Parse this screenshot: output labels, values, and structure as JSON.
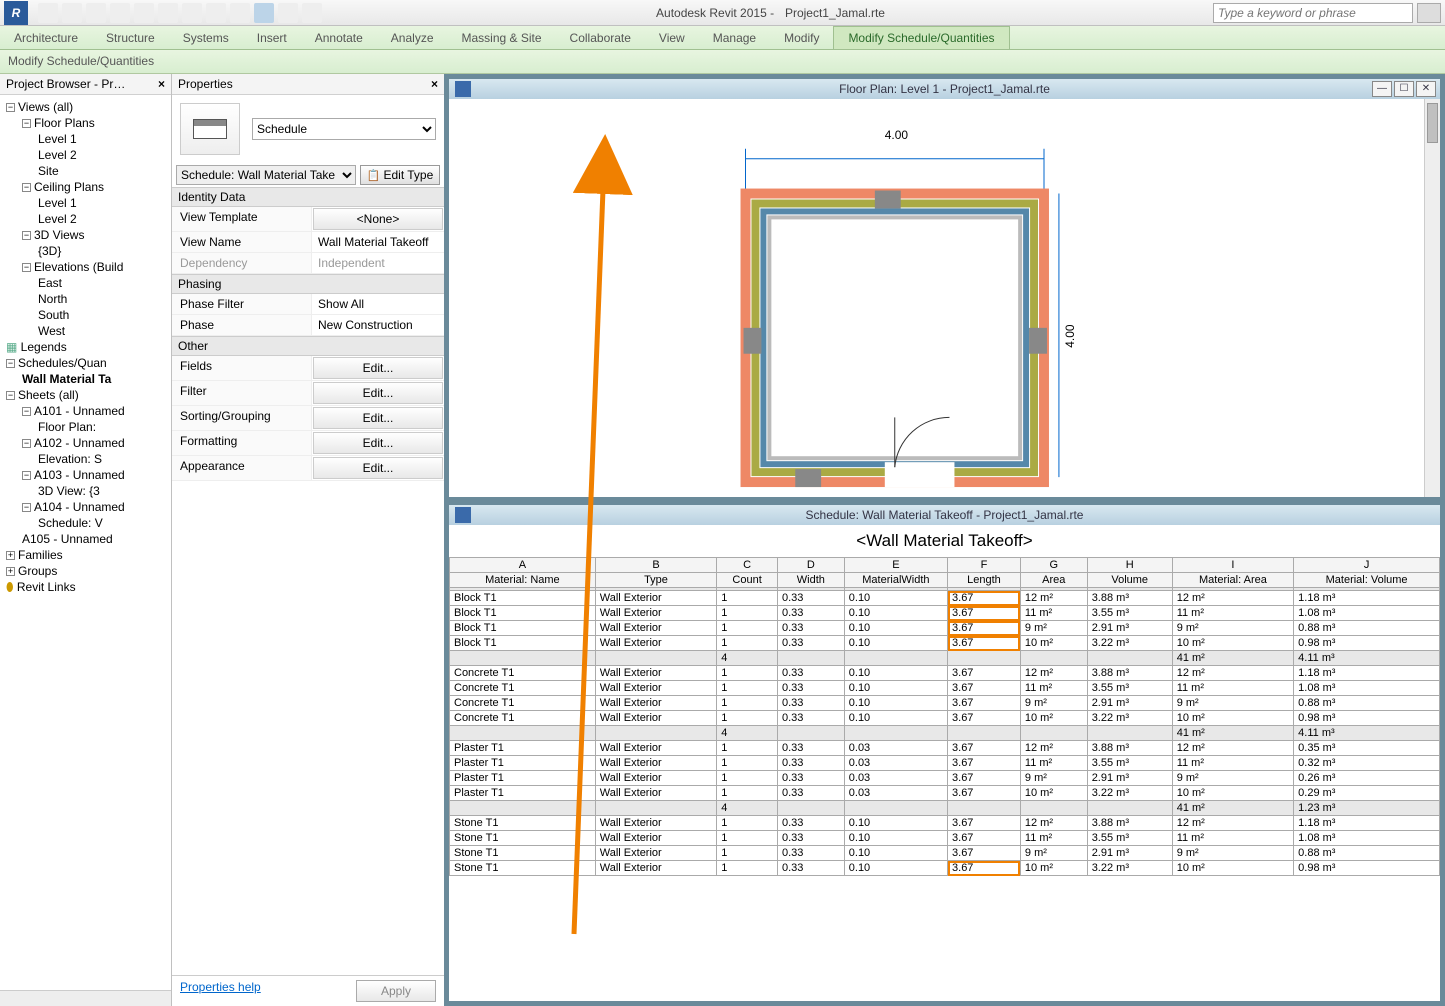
{
  "app": {
    "title_left": "Autodesk Revit 2015 -",
    "title_file": "Project1_Jamal.rte",
    "search_placeholder": "Type a keyword or phrase"
  },
  "ribbon": {
    "tabs": [
      "Architecture",
      "Structure",
      "Systems",
      "Insert",
      "Annotate",
      "Analyze",
      "Massing & Site",
      "Collaborate",
      "View",
      "Manage",
      "Modify",
      "Modify Schedule/Quantities"
    ],
    "panel_label": "Modify Schedule/Quantities"
  },
  "browser": {
    "title": "Project Browser - Pr…",
    "tree": [
      {
        "lvl": 1,
        "label": "Views (all)",
        "box": "-"
      },
      {
        "lvl": 2,
        "label": "Floor Plans",
        "box": "-"
      },
      {
        "lvl": 3,
        "label": "Level 1"
      },
      {
        "lvl": 3,
        "label": "Level 2"
      },
      {
        "lvl": 3,
        "label": "Site"
      },
      {
        "lvl": 2,
        "label": "Ceiling Plans",
        "box": "-"
      },
      {
        "lvl": 3,
        "label": "Level 1"
      },
      {
        "lvl": 3,
        "label": "Level 2"
      },
      {
        "lvl": 2,
        "label": "3D Views",
        "box": "-"
      },
      {
        "lvl": 3,
        "label": "{3D}"
      },
      {
        "lvl": 2,
        "label": "Elevations (Build",
        "box": "-"
      },
      {
        "lvl": 3,
        "label": "East"
      },
      {
        "lvl": 3,
        "label": "North"
      },
      {
        "lvl": 3,
        "label": "South"
      },
      {
        "lvl": 3,
        "label": "West"
      },
      {
        "lvl": 1,
        "label": "Legends",
        "icon": "legend"
      },
      {
        "lvl": 1,
        "label": "Schedules/Quan",
        "box": "-"
      },
      {
        "lvl": 2,
        "label": "Wall Material Ta",
        "bold": true
      },
      {
        "lvl": 1,
        "label": "Sheets (all)",
        "box": "-"
      },
      {
        "lvl": 2,
        "label": "A101 - Unnamed",
        "box": "-"
      },
      {
        "lvl": 3,
        "label": "Floor Plan:"
      },
      {
        "lvl": 2,
        "label": "A102 - Unnamed",
        "box": "-"
      },
      {
        "lvl": 3,
        "label": "Elevation: S"
      },
      {
        "lvl": 2,
        "label": "A103 - Unnamed",
        "box": "-"
      },
      {
        "lvl": 3,
        "label": "3D View: {3"
      },
      {
        "lvl": 2,
        "label": "A104 - Unnamed",
        "box": "-"
      },
      {
        "lvl": 3,
        "label": "Schedule: V"
      },
      {
        "lvl": 2,
        "label": "A105 - Unnamed"
      },
      {
        "lvl": 1,
        "label": "Families",
        "box": "+"
      },
      {
        "lvl": 1,
        "label": "Groups",
        "box": "+"
      },
      {
        "lvl": 1,
        "label": "Revit Links",
        "icon": "link"
      }
    ]
  },
  "properties": {
    "title": "Properties",
    "type_selector": "Schedule",
    "instance_selector": "Schedule: Wall Material Take",
    "edit_type": "Edit Type",
    "groups": [
      {
        "name": "Identity Data",
        "rows": [
          {
            "k": "View Template",
            "v": "<None>",
            "btn": true
          },
          {
            "k": "View Name",
            "v": "Wall Material Takeoff"
          },
          {
            "k": "Dependency",
            "v": "Independent",
            "dim": true
          }
        ]
      },
      {
        "name": "Phasing",
        "rows": [
          {
            "k": "Phase Filter",
            "v": "Show All"
          },
          {
            "k": "Phase",
            "v": "New Construction"
          }
        ]
      },
      {
        "name": "Other",
        "rows": [
          {
            "k": "Fields",
            "v": "Edit...",
            "btn": true
          },
          {
            "k": "Filter",
            "v": "Edit...",
            "btn": true
          },
          {
            "k": "Sorting/Grouping",
            "v": "Edit...",
            "btn": true
          },
          {
            "k": "Formatting",
            "v": "Edit...",
            "btn": true
          },
          {
            "k": "Appearance",
            "v": "Edit...",
            "btn": true
          }
        ]
      }
    ],
    "help": "Properties help",
    "apply": "Apply"
  },
  "floorplan": {
    "title": "Floor Plan: Level 1 - Project1_Jamal.rte",
    "dim_h": "4.00",
    "dim_v": "4.00"
  },
  "schedule": {
    "title": "Schedule: Wall Material Takeoff - Project1_Jamal.rte",
    "heading": "<Wall Material Takeoff>",
    "col_letters": [
      "A",
      "B",
      "C",
      "D",
      "E",
      "F",
      "G",
      "H",
      "I",
      "J"
    ],
    "col_names": [
      "Material: Name",
      "Type",
      "Count",
      "Width",
      "MaterialWidth",
      "Length",
      "Area",
      "Volume",
      "Material: Area",
      "Material: Volume"
    ],
    "groups": [
      {
        "rows": [
          [
            "Block T1",
            "Wall Exterior",
            "1",
            "0.33",
            "0.10",
            "3.67",
            "12 m²",
            "3.88 m³",
            "12 m²",
            "1.18 m³"
          ],
          [
            "Block T1",
            "Wall Exterior",
            "1",
            "0.33",
            "0.10",
            "3.67",
            "11 m²",
            "3.55 m³",
            "11 m²",
            "1.08 m³"
          ],
          [
            "Block T1",
            "Wall Exterior",
            "1",
            "0.33",
            "0.10",
            "3.67",
            "9 m²",
            "2.91 m³",
            "9 m²",
            "0.88 m³"
          ],
          [
            "Block T1",
            "Wall Exterior",
            "1",
            "0.33",
            "0.10",
            "3.67",
            "10 m²",
            "3.22 m³",
            "10 m²",
            "0.98 m³"
          ]
        ],
        "sub": [
          "",
          "",
          "4",
          "",
          "",
          "",
          "",
          "",
          "41 m²",
          "4.11 m³"
        ],
        "hl": true
      },
      {
        "rows": [
          [
            "Concrete T1",
            "Wall Exterior",
            "1",
            "0.33",
            "0.10",
            "3.67",
            "12 m²",
            "3.88 m³",
            "12 m²",
            "1.18 m³"
          ],
          [
            "Concrete T1",
            "Wall Exterior",
            "1",
            "0.33",
            "0.10",
            "3.67",
            "11 m²",
            "3.55 m³",
            "11 m²",
            "1.08 m³"
          ],
          [
            "Concrete T1",
            "Wall Exterior",
            "1",
            "0.33",
            "0.10",
            "3.67",
            "9 m²",
            "2.91 m³",
            "9 m²",
            "0.88 m³"
          ],
          [
            "Concrete T1",
            "Wall Exterior",
            "1",
            "0.33",
            "0.10",
            "3.67",
            "10 m²",
            "3.22 m³",
            "10 m²",
            "0.98 m³"
          ]
        ],
        "sub": [
          "",
          "",
          "4",
          "",
          "",
          "",
          "",
          "",
          "41 m²",
          "4.11 m³"
        ]
      },
      {
        "rows": [
          [
            "Plaster T1",
            "Wall Exterior",
            "1",
            "0.33",
            "0.03",
            "3.67",
            "12 m²",
            "3.88 m³",
            "12 m²",
            "0.35 m³"
          ],
          [
            "Plaster T1",
            "Wall Exterior",
            "1",
            "0.33",
            "0.03",
            "3.67",
            "11 m²",
            "3.55 m³",
            "11 m²",
            "0.32 m³"
          ],
          [
            "Plaster T1",
            "Wall Exterior",
            "1",
            "0.33",
            "0.03",
            "3.67",
            "9 m²",
            "2.91 m³",
            "9 m²",
            "0.26 m³"
          ],
          [
            "Plaster T1",
            "Wall Exterior",
            "1",
            "0.33",
            "0.03",
            "3.67",
            "10 m²",
            "3.22 m³",
            "10 m²",
            "0.29 m³"
          ]
        ],
        "sub": [
          "",
          "",
          "4",
          "",
          "",
          "",
          "",
          "",
          "41 m²",
          "1.23 m³"
        ]
      },
      {
        "rows": [
          [
            "Stone T1",
            "Wall Exterior",
            "1",
            "0.33",
            "0.10",
            "3.67",
            "12 m²",
            "3.88 m³",
            "12 m²",
            "1.18 m³"
          ],
          [
            "Stone T1",
            "Wall Exterior",
            "1",
            "0.33",
            "0.10",
            "3.67",
            "11 m²",
            "3.55 m³",
            "11 m²",
            "1.08 m³"
          ],
          [
            "Stone T1",
            "Wall Exterior",
            "1",
            "0.33",
            "0.10",
            "3.67",
            "9 m²",
            "2.91 m³",
            "9 m²",
            "0.88 m³"
          ],
          [
            "Stone T1",
            "Wall Exterior",
            "1",
            "0.33",
            "0.10",
            "3.67",
            "10 m²",
            "3.22 m³",
            "10 m²",
            "0.98 m³"
          ]
        ],
        "hl_last": true
      }
    ]
  }
}
